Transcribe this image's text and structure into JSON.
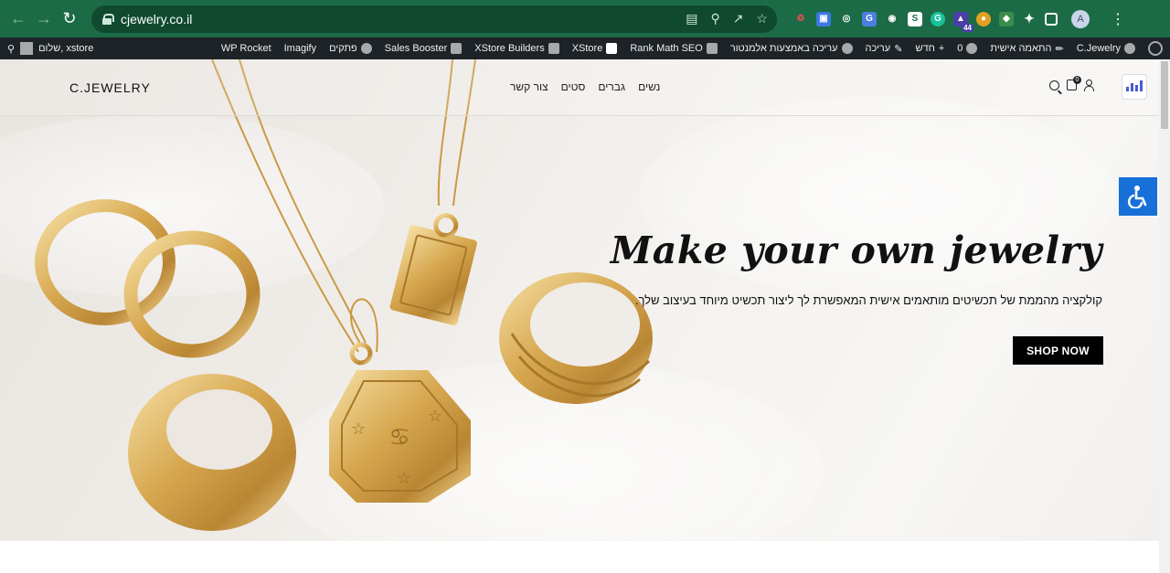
{
  "browser": {
    "url": "cjewelry.co.il",
    "avatar_letter": "A",
    "extension_badge": "44",
    "accent": "#1c6b47"
  },
  "wp_admin": {
    "greeting": "שלום, xstore",
    "items": [
      "WP Rocket",
      "Imagify",
      "פתקים",
      "Sales Booster",
      "XStore Builders",
      "XStore",
      "Rank Math SEO",
      "עריכה באמצעות אלמנטור",
      "עריכה",
      "חדש",
      "0",
      "התאמה אישית",
      "C.Jewelry"
    ]
  },
  "site": {
    "logo": "C.JEWELRY",
    "menu": [
      "נשים",
      "גברים",
      "סטים",
      "צור קשר"
    ],
    "cart_count": "0"
  },
  "hero": {
    "title": "Make your own jewelry",
    "subtitle": "קולקציה מהממת של תכשיטים מותאמים אישית המאפשרת לך ליצור תכשיט מיוחד בעיצוב שלך.",
    "cta": "SHOP NOW"
  },
  "accessibility": {
    "color": "#1670d8"
  }
}
